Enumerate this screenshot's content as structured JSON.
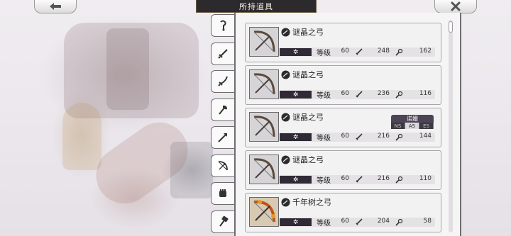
{
  "header": {
    "title": "所持道具",
    "back_icon": "arrow-left-icon",
    "close_icon": "close-x-icon"
  },
  "tabs": [
    {
      "icon": "amulet-icon",
      "active": false
    },
    {
      "icon": "sword-icon",
      "active": false
    },
    {
      "icon": "saber-icon",
      "active": false
    },
    {
      "icon": "axe-icon",
      "active": false
    },
    {
      "icon": "spear-icon",
      "active": false
    },
    {
      "icon": "bow-icon",
      "active": true
    },
    {
      "icon": "fist-icon",
      "active": false
    },
    {
      "icon": "hammer-icon",
      "active": false
    }
  ],
  "items": [
    {
      "name": "谜晶之弓",
      "level_label": "等级",
      "level": "60",
      "atk": "248",
      "matk": "162",
      "rare": false
    },
    {
      "name": "谜晶之弓",
      "level_label": "等级",
      "level": "60",
      "atk": "236",
      "matk": "116",
      "rare": false
    },
    {
      "name": "谜晶之弓",
      "level_label": "等级",
      "level": "60",
      "atk": "216",
      "matk": "144",
      "rare": false,
      "badge": {
        "owner": "诺姗",
        "slots": [
          "NS",
          "AS",
          "ES"
        ],
        "active_slot": "AS"
      }
    },
    {
      "name": "谜晶之弓",
      "level_label": "等级",
      "level": "60",
      "atk": "216",
      "matk": "110",
      "rare": false
    },
    {
      "name": "千年树之弓",
      "level_label": "等级",
      "level": "60",
      "atk": "204",
      "matk": "58",
      "rare": true
    }
  ],
  "colors": {
    "accent_dark": "#2f2a36",
    "panel_border": "#6f6d70",
    "badge_bg": "#4d4458"
  }
}
